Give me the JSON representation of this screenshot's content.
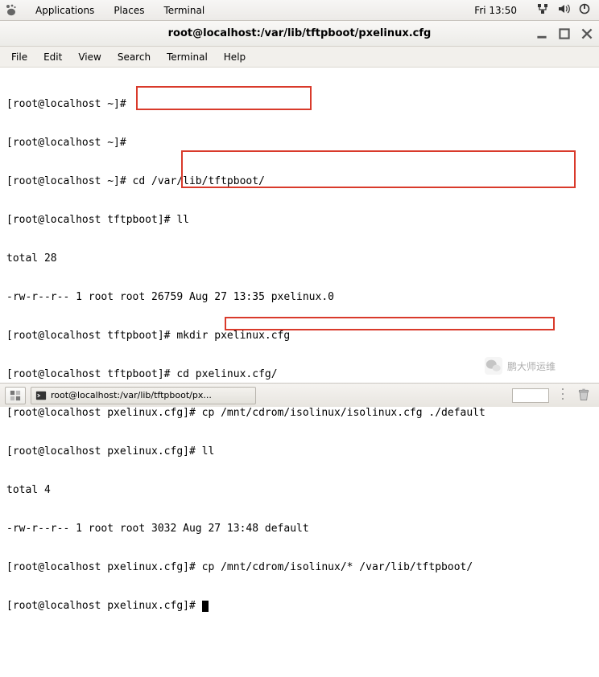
{
  "topbar": {
    "menus": [
      "Applications",
      "Places",
      "Terminal"
    ],
    "clock": "Fri 13:50"
  },
  "window": {
    "title": "root@localhost:/var/lib/tftpboot/pxelinux.cfg"
  },
  "menubar": [
    "File",
    "Edit",
    "View",
    "Search",
    "Terminal",
    "Help"
  ],
  "terminal_lines": [
    "[root@localhost ~]#",
    "[root@localhost ~]#",
    "[root@localhost ~]# cd /var/lib/tftpboot/",
    "[root@localhost tftpboot]# ll",
    "total 28",
    "-rw-r--r-- 1 root root 26759 Aug 27 13:35 pxelinux.0",
    "[root@localhost tftpboot]# mkdir pxelinux.cfg",
    "[root@localhost tftpboot]# cd pxelinux.cfg/",
    "[root@localhost pxelinux.cfg]# cp /mnt/cdrom/isolinux/isolinux.cfg ./default",
    "[root@localhost pxelinux.cfg]# ll",
    "total 4",
    "-rw-r--r-- 1 root root 3032 Aug 27 13:48 default",
    "[root@localhost pxelinux.cfg]# cp /mnt/cdrom/isolinux/* /var/lib/tftpboot/",
    "[root@localhost pxelinux.cfg]# "
  ],
  "taskbar": {
    "task_label": "root@localhost:/var/lib/tftpboot/px..."
  },
  "watermark": "鹏大师运维"
}
